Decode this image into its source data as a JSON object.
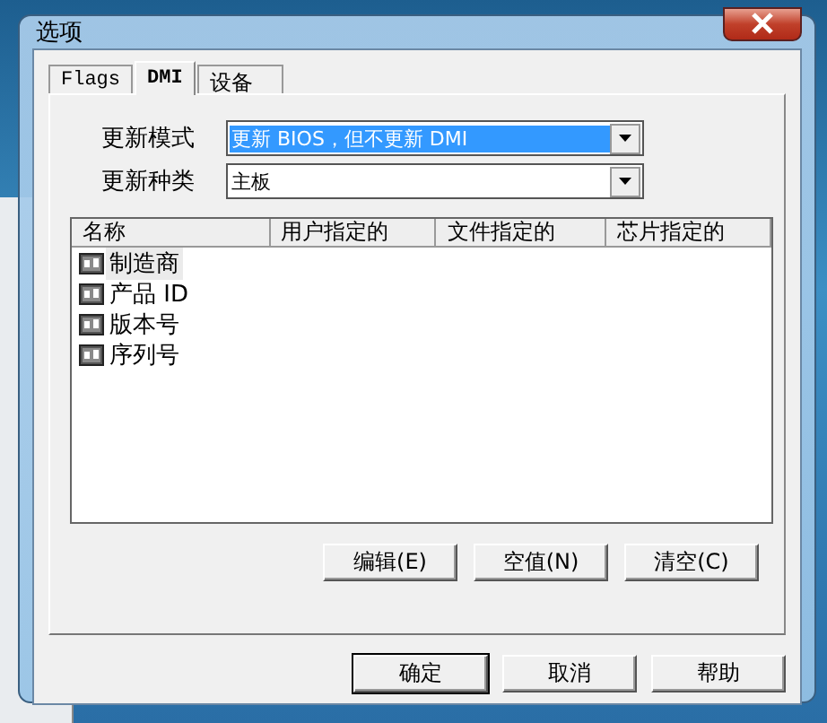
{
  "window": {
    "title": "选项"
  },
  "tabs": [
    {
      "label": "Flags",
      "selected": false
    },
    {
      "label": "DMI",
      "selected": true
    },
    {
      "label": "设备",
      "selected": false
    }
  ],
  "fields": [
    {
      "label": "更新模式",
      "value": "更新 BIOS，但不更新 DMI",
      "highlighted": true
    },
    {
      "label": "更新种类",
      "value": "主板",
      "highlighted": false
    }
  ],
  "list": {
    "columns": [
      "名称",
      "用户指定的",
      "文件指定的",
      "芯片指定的"
    ],
    "rows": [
      {
        "name": "制造商",
        "selected": true
      },
      {
        "name": "产品 ID",
        "selected": false
      },
      {
        "name": "版本号",
        "selected": false
      },
      {
        "name": "序列号",
        "selected": false
      }
    ]
  },
  "list_buttons": [
    "编辑(E)",
    "空值(N)",
    "清空(C)"
  ],
  "dialog_buttons": [
    {
      "label": "确定",
      "default": true
    },
    {
      "label": "取消",
      "default": false
    },
    {
      "label": "帮助",
      "default": false
    }
  ]
}
